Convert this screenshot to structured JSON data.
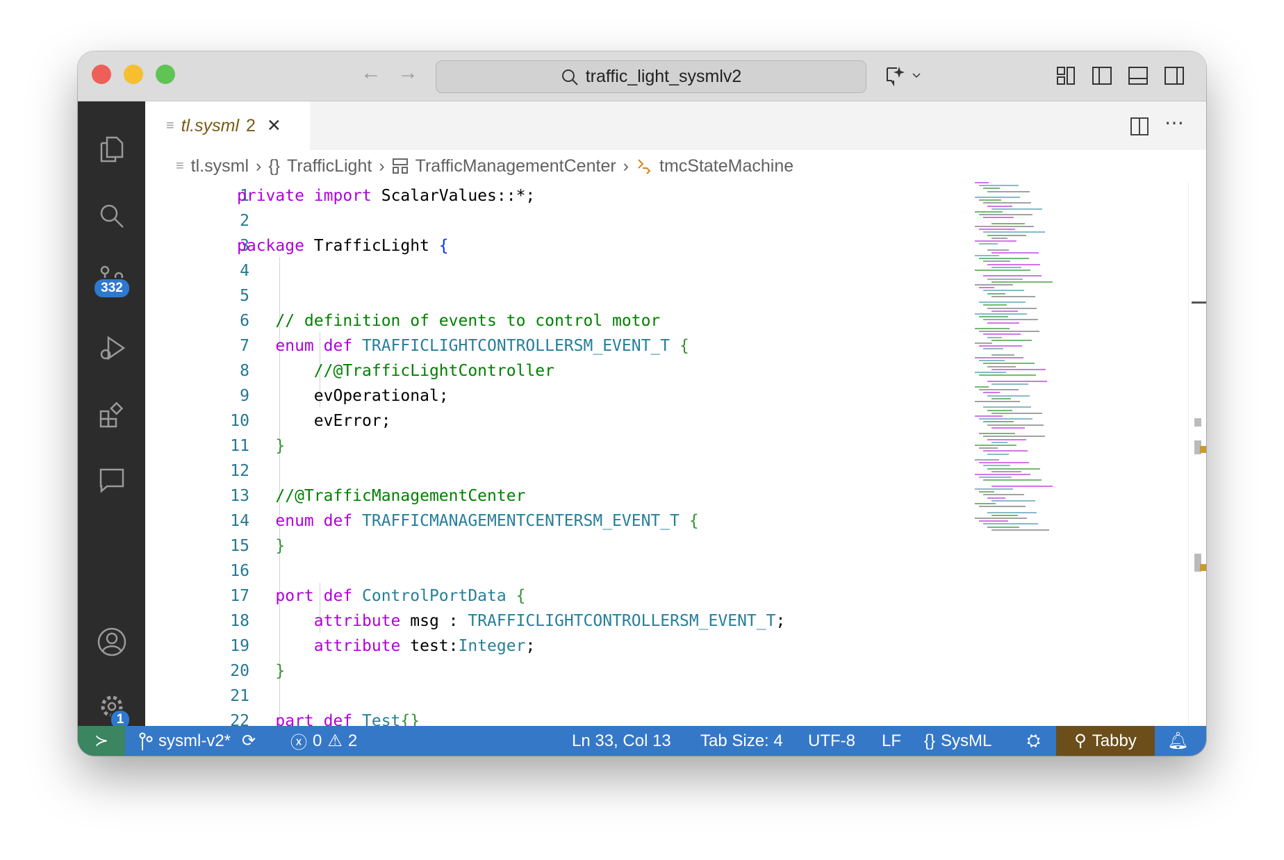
{
  "titlebar": {
    "search_text": "traffic_light_sysmlv2",
    "back": "←",
    "forward": "→"
  },
  "activity_bar": {
    "scm_badge": "332",
    "settings_badge": "1"
  },
  "tab": {
    "name": "tl.sysml",
    "problems": "2",
    "close": "✕"
  },
  "breadcrumb": [
    "tl.sysml",
    "TrafficLight",
    "TrafficManagementCenter",
    "tmcStateMachine"
  ],
  "code": [
    [
      [
        "private import ",
        "kw"
      ],
      [
        "ScalarValues::*;",
        ""
      ]
    ],
    [],
    [
      [
        "package ",
        "kw"
      ],
      [
        "TrafficLight ",
        ""
      ],
      [
        "{",
        "bb"
      ]
    ],
    [],
    [],
    [
      [
        "    // definition of events to control motor",
        "cm"
      ]
    ],
    [
      [
        "    enum def ",
        "kw"
      ],
      [
        "TRAFFICLIGHTCONTROLLERSM_EVENT_T ",
        "ty"
      ],
      [
        "{",
        "bg"
      ]
    ],
    [
      [
        "        //@TrafficLightController",
        "cm"
      ]
    ],
    [
      [
        "        evOperational;",
        ""
      ]
    ],
    [
      [
        "        evError;",
        ""
      ]
    ],
    [
      [
        "    }",
        "bg"
      ]
    ],
    [],
    [
      [
        "    //@TrafficManagementCenter",
        "cm"
      ]
    ],
    [
      [
        "    enum def ",
        "kw"
      ],
      [
        "TRAFFICMANAGEMENTCENTERSM_EVENT_T ",
        "ty"
      ],
      [
        "{",
        "bg"
      ]
    ],
    [
      [
        "    }",
        "bg"
      ]
    ],
    [],
    [
      [
        "    port def ",
        "kw"
      ],
      [
        "ControlPortData ",
        "ty"
      ],
      [
        "{",
        "bg"
      ]
    ],
    [
      [
        "        attribute ",
        "kw"
      ],
      [
        "msg : ",
        ""
      ],
      [
        "TRAFFICLIGHTCONTROLLERSM_EVENT_T",
        "ty"
      ],
      [
        ";",
        ""
      ]
    ],
    [
      [
        "        attribute ",
        "kw"
      ],
      [
        "test:",
        ""
      ],
      [
        "Integer",
        "ty"
      ],
      [
        ";",
        ""
      ]
    ],
    [
      [
        "    }",
        "bg"
      ]
    ],
    [],
    [
      [
        "    part def ",
        "kw"
      ],
      [
        "Test",
        "ty"
      ],
      [
        "{}",
        "bg"
      ]
    ]
  ],
  "statusbar": {
    "branch": "sysml-v2*",
    "errors": "0",
    "warnings": "2",
    "position": "Ln 33, Col 13",
    "tab_size": "Tab Size: 4",
    "encoding": "UTF-8",
    "eol": "LF",
    "language": "SysML",
    "tabby": "Tabby"
  },
  "colors": {
    "statusbar": "#3578c8",
    "remote": "#3b8560",
    "tabby": "#6b4e1a",
    "keyword": "#af00db",
    "type": "#267f99",
    "comment": "#008000"
  }
}
